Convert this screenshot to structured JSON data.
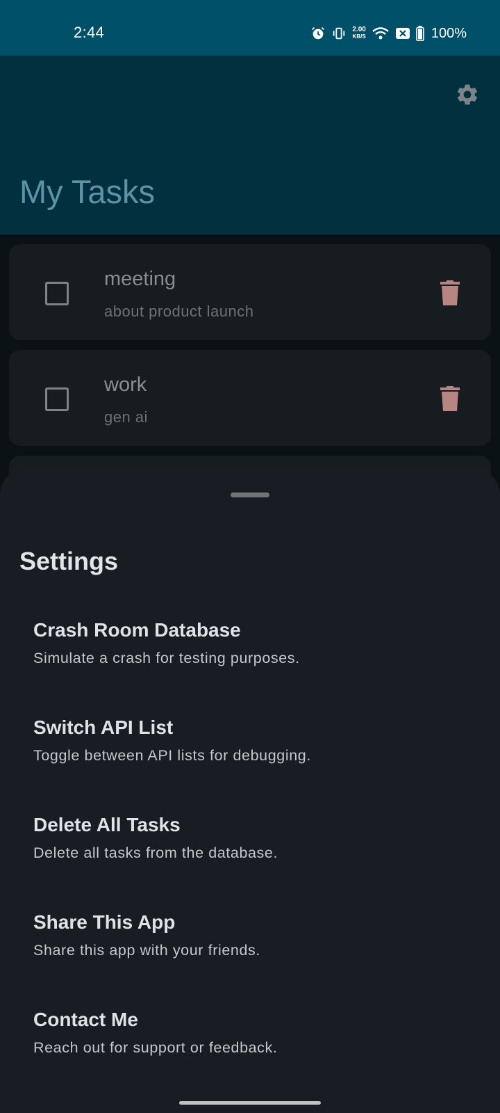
{
  "status_bar": {
    "time": "2:44",
    "net_speed_value": "2.00",
    "net_speed_unit": "KB/S",
    "battery": "100%"
  },
  "app_bar": {
    "title": "My Tasks",
    "settings_icon": "gear-icon"
  },
  "tasks": [
    {
      "title": "meeting",
      "description": "about product launch",
      "checked": false
    },
    {
      "title": "work",
      "description": "gen ai",
      "checked": false
    }
  ],
  "settings_sheet": {
    "title": "Settings",
    "items": [
      {
        "title": "Crash Room Database",
        "subtitle": "Simulate a crash for testing purposes."
      },
      {
        "title": "Switch API List",
        "subtitle": "Toggle between API lists for debugging."
      },
      {
        "title": "Delete All Tasks",
        "subtitle": "Delete all tasks from the database."
      },
      {
        "title": "Share This App",
        "subtitle": "Share this app with your friends."
      },
      {
        "title": "Contact Me",
        "subtitle": "Reach out for support or feedback."
      }
    ]
  },
  "colors": {
    "status_bar": "#00506a",
    "app_bar": "#02303f",
    "title_accent": "#5d93a6",
    "delete_icon": "#b98582",
    "sheet_background": "#171d23"
  }
}
